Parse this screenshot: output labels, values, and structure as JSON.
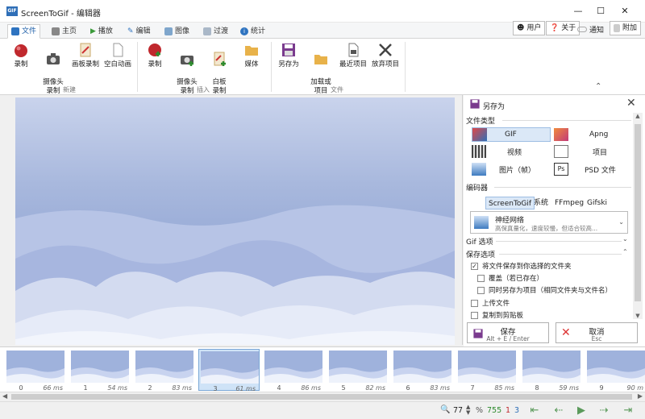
{
  "window": {
    "title": "ScreenToGif - 编辑器",
    "icon_text": "GIF"
  },
  "tabs": [
    {
      "label": "文件",
      "active": true
    },
    {
      "label": "主页"
    },
    {
      "label": "播放"
    },
    {
      "label": "编辑"
    },
    {
      "label": "图像"
    },
    {
      "label": "过渡"
    },
    {
      "label": "统计"
    }
  ],
  "right_tabs": {
    "user": "用户",
    "about": "关于",
    "notify": "通知",
    "attach": "附加"
  },
  "ribbon": {
    "new_group": "新建",
    "insert_group": "插入",
    "file_group": "文件",
    "new": [
      "录制",
      "摄像头\n录制",
      "画板录制",
      "空白动画"
    ],
    "insert": [
      "录制",
      "摄像头\n录制",
      "白板\n录制",
      "媒体"
    ],
    "file": [
      "另存为",
      "加载或\n项目",
      "最近项目",
      "放弃项目"
    ]
  },
  "panel": {
    "title": "另存为",
    "file_type_label": "文件类型",
    "file_types": [
      "GIF",
      "Apng",
      "视频",
      "项目",
      "图片（帧）",
      "PSD 文件"
    ],
    "encoder_label": "编码器",
    "encoders": [
      "ScreenToGif",
      "系统",
      "FFmpeg",
      "Gifski"
    ],
    "encoder_selected": {
      "title": "神经网络",
      "desc": "高保真量化，速度较慢，但适合较高..."
    },
    "gif_options": "Gif 选项",
    "save_options": "保存选项",
    "options": [
      {
        "label": "将文件保存到你选择的文件夹",
        "checked": true
      },
      {
        "label": "覆盖（若已存在）",
        "checked": false
      },
      {
        "label": "同时另存为项目（相同文件夹与文件名）",
        "checked": false
      },
      {
        "label": "上传文件",
        "checked": false
      },
      {
        "label": "复制到剪贴板",
        "checked": false
      }
    ],
    "save_label": "保存",
    "save_shortcut": "Alt + E / Enter",
    "cancel_label": "取消",
    "cancel_shortcut": "Esc"
  },
  "frames": [
    {
      "num": "0",
      "ms": "66 ms"
    },
    {
      "num": "1",
      "ms": "54 ms"
    },
    {
      "num": "2",
      "ms": "83 ms"
    },
    {
      "num": "3",
      "ms": "61 ms",
      "selected": true
    },
    {
      "num": "4",
      "ms": "86 ms"
    },
    {
      "num": "5",
      "ms": "82 ms"
    },
    {
      "num": "6",
      "ms": "83 ms"
    },
    {
      "num": "7",
      "ms": "85 ms"
    },
    {
      "num": "8",
      "ms": "59 ms"
    },
    {
      "num": "9",
      "ms": "90 m"
    }
  ],
  "status": {
    "zoom": "77",
    "percent": "%",
    "total_frames": "755",
    "selected_count": "1",
    "current_frame": "3"
  },
  "colors": {
    "accent": "#1e5fa8",
    "green": "#2e8b2e",
    "blue": "#2f6fb7"
  }
}
